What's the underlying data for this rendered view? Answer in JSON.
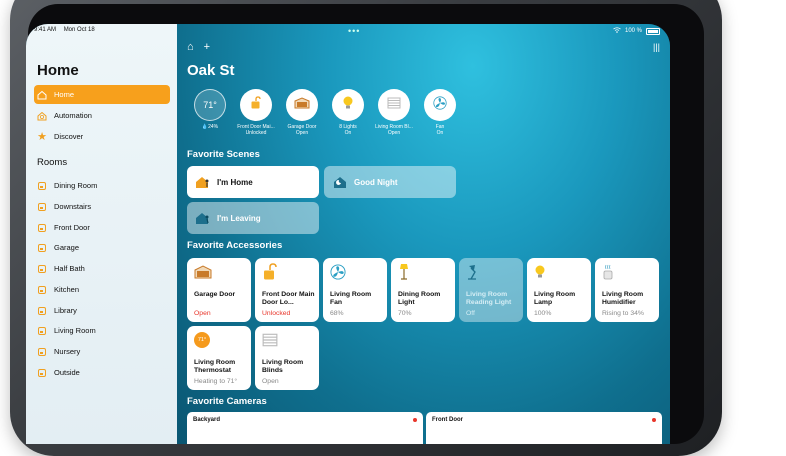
{
  "status_bar": {
    "time": "9:41 AM",
    "date": "Mon Oct 18",
    "battery": "100 %",
    "top_dots": "•••"
  },
  "sidebar": {
    "title": "Home",
    "nav": [
      {
        "label": "Home",
        "icon": "house-icon",
        "active": true
      },
      {
        "label": "Automation",
        "icon": "clock-icon",
        "active": false
      },
      {
        "label": "Discover",
        "icon": "star-icon",
        "active": false
      }
    ],
    "rooms_heading": "Rooms",
    "rooms": [
      "Dining Room",
      "Downstairs",
      "Front Door",
      "Garage",
      "Half Bath",
      "Kitchen",
      "Library",
      "Living Room",
      "Nursery",
      "Outside"
    ]
  },
  "main": {
    "home_name": "Oak St",
    "top_icons": {
      "home": "⌂",
      "add": "+",
      "voice": "|||"
    },
    "status": [
      {
        "value": "71°",
        "label": "💧24%",
        "icon": "thermometer-icon"
      },
      {
        "label1": "Front Door Mai...",
        "label2": "Unlocked",
        "icon": "lock-open-icon"
      },
      {
        "label1": "Garage Door",
        "label2": "Open",
        "icon": "garage-icon"
      },
      {
        "label1": "8 Lights",
        "label2": "On",
        "icon": "bulb-icon"
      },
      {
        "label1": "Living Room Bl...",
        "label2": "Open",
        "icon": "blinds-icon"
      },
      {
        "label1": "Fan",
        "label2": "On",
        "icon": "fan-icon"
      }
    ],
    "scenes_heading": "Favorite Scenes",
    "scenes": [
      {
        "label": "I'm Home",
        "state": "on"
      },
      {
        "label": "Good Night",
        "state": "off"
      },
      {
        "label": "I'm Leaving",
        "state": "off"
      }
    ],
    "accessories_heading": "Favorite Accessories",
    "accessories": [
      {
        "name": "Garage Door",
        "status": "Open",
        "icon": "garage-icon",
        "state": "on",
        "alert": false
      },
      {
        "name": "Front Door Main Door Lo...",
        "status": "Unlocked",
        "icon": "lock-open-icon",
        "state": "on",
        "alert": true
      },
      {
        "name": "Living Room Fan",
        "status": "68%",
        "icon": "fan-icon",
        "state": "on",
        "alert": false
      },
      {
        "name": "Dining Room Light",
        "status": "70%",
        "icon": "floor-lamp-icon",
        "state": "on",
        "alert": false
      },
      {
        "name": "Living Room Reading Light",
        "status": "Off",
        "icon": "desk-lamp-icon",
        "state": "off",
        "alert": false
      },
      {
        "name": "Living Room Lamp",
        "status": "100%",
        "icon": "bulb-icon",
        "state": "on",
        "alert": false
      },
      {
        "name": "Living Room Humidifier",
        "status": "Rising to 34%",
        "icon": "humidifier-icon",
        "state": "on",
        "alert": false
      },
      {
        "name": "Living Room Thermostat",
        "status": "Heating to 71°",
        "icon": "thermostat-icon",
        "state": "on",
        "alert": false,
        "badge": "71°"
      },
      {
        "name": "Living Room Blinds",
        "status": "Open",
        "icon": "blinds-icon",
        "state": "on",
        "alert": false
      }
    ],
    "cameras_heading": "Favorite Cameras",
    "cameras": [
      {
        "name": "Backyard"
      },
      {
        "name": "Front Door"
      }
    ]
  }
}
